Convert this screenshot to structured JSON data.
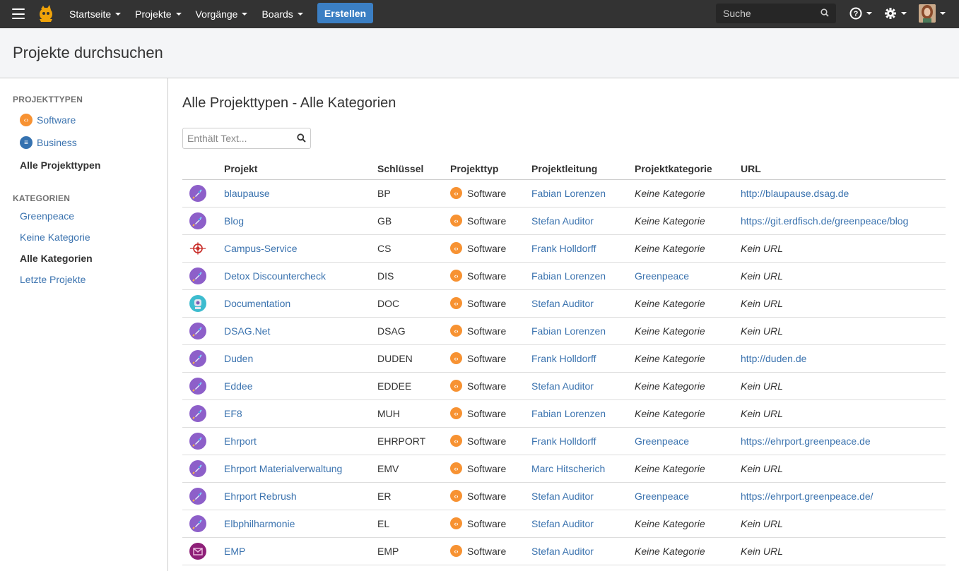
{
  "topbar": {
    "nav": [
      {
        "label": "Startseite"
      },
      {
        "label": "Projekte"
      },
      {
        "label": "Vorgänge"
      },
      {
        "label": "Boards"
      }
    ],
    "create_label": "Erstellen",
    "search_placeholder": "Suche",
    "colors": {
      "bar": "#333333",
      "create": "#3b7fc4"
    }
  },
  "header": {
    "title": "Projekte durchsuchen"
  },
  "sidebar": {
    "types_heading": "PROJEKTTYPEN",
    "types": [
      {
        "label": "Software",
        "icon": "software-icon"
      },
      {
        "label": "Business",
        "icon": "business-icon"
      },
      {
        "label": "Alle Projekttypen",
        "active": true
      }
    ],
    "categories_heading": "KATEGORIEN",
    "categories": [
      {
        "label": "Greenpeace"
      },
      {
        "label": "Keine Kategorie"
      },
      {
        "label": "Alle Kategorien",
        "active": true
      },
      {
        "label": "Letzte Projekte"
      }
    ]
  },
  "main": {
    "title": "Alle Projekttypen - Alle Kategorien",
    "filter_placeholder": "Enthält Text...",
    "columns": [
      "Projekt",
      "Schlüssel",
      "Projekttyp",
      "Projektleitung",
      "Projektkategorie",
      "URL"
    ],
    "rows": [
      {
        "icon": "rocket-icon",
        "name": "blaupause",
        "key": "BP",
        "type": "Software",
        "lead": "Fabian Lorenzen",
        "category": "Keine Kategorie",
        "category_is_link": false,
        "url": "http://blaupause.dsag.de",
        "url_is_link": true
      },
      {
        "icon": "rocket-icon",
        "name": "Blog",
        "key": "GB",
        "type": "Software",
        "lead": "Stefan Auditor",
        "category": "Keine Kategorie",
        "category_is_link": false,
        "url": "https://git.erdfisch.de/greenpeace/blog",
        "url_is_link": true
      },
      {
        "icon": "target-icon",
        "name": "Campus-Service",
        "key": "CS",
        "type": "Software",
        "lead": "Frank Holldorff",
        "category": "Keine Kategorie",
        "category_is_link": false,
        "url": "Kein URL",
        "url_is_link": false
      },
      {
        "icon": "rocket-icon",
        "name": "Detox Discountercheck",
        "key": "DIS",
        "type": "Software",
        "lead": "Fabian Lorenzen",
        "category": "Greenpeace",
        "category_is_link": true,
        "url": "Kein URL",
        "url_is_link": false
      },
      {
        "icon": "robot-icon",
        "name": "Documentation",
        "key": "DOC",
        "type": "Software",
        "lead": "Stefan Auditor",
        "category": "Keine Kategorie",
        "category_is_link": false,
        "url": "Kein URL",
        "url_is_link": false
      },
      {
        "icon": "rocket-icon",
        "name": "DSAG.Net",
        "key": "DSAG",
        "type": "Software",
        "lead": "Fabian Lorenzen",
        "category": "Keine Kategorie",
        "category_is_link": false,
        "url": "Kein URL",
        "url_is_link": false
      },
      {
        "icon": "rocket-icon",
        "name": "Duden",
        "key": "DUDEN",
        "type": "Software",
        "lead": "Frank Holldorff",
        "category": "Keine Kategorie",
        "category_is_link": false,
        "url": "http://duden.de",
        "url_is_link": true
      },
      {
        "icon": "rocket-icon",
        "name": "Eddee",
        "key": "EDDEE",
        "type": "Software",
        "lead": "Stefan Auditor",
        "category": "Keine Kategorie",
        "category_is_link": false,
        "url": "Kein URL",
        "url_is_link": false
      },
      {
        "icon": "rocket-icon",
        "name": "EF8",
        "key": "MUH",
        "type": "Software",
        "lead": "Fabian Lorenzen",
        "category": "Keine Kategorie",
        "category_is_link": false,
        "url": "Kein URL",
        "url_is_link": false
      },
      {
        "icon": "rocket-icon",
        "name": "Ehrport",
        "key": "EHRPORT",
        "type": "Software",
        "lead": "Frank Holldorff",
        "category": "Greenpeace",
        "category_is_link": true,
        "url": "https://ehrport.greenpeace.de",
        "url_is_link": true
      },
      {
        "icon": "rocket-icon",
        "name": "Ehrport Materialverwaltung",
        "key": "EMV",
        "type": "Software",
        "lead": "Marc Hitscherich",
        "category": "Keine Kategorie",
        "category_is_link": false,
        "url": "Kein URL",
        "url_is_link": false
      },
      {
        "icon": "rocket-icon",
        "name": "Ehrport Rebrush",
        "key": "ER",
        "type": "Software",
        "lead": "Stefan Auditor",
        "category": "Greenpeace",
        "category_is_link": true,
        "url": "https://ehrport.greenpeace.de/",
        "url_is_link": true
      },
      {
        "icon": "rocket-icon",
        "name": "Elbphilharmonie",
        "key": "EL",
        "type": "Software",
        "lead": "Stefan Auditor",
        "category": "Keine Kategorie",
        "category_is_link": false,
        "url": "Kein URL",
        "url_is_link": false
      },
      {
        "icon": "envelope-icon",
        "name": "EMP",
        "key": "EMP",
        "type": "Software",
        "lead": "Stefan Auditor",
        "category": "Keine Kategorie",
        "category_is_link": false,
        "url": "Kein URL",
        "url_is_link": false
      }
    ]
  }
}
